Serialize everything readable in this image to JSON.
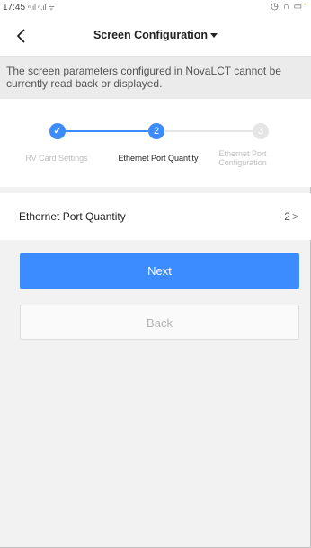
{
  "status_bar": {
    "time": "17:45",
    "signal_text": "⁴ᴳ.ıl ⁴ᴳ.ıl",
    "right_icons_text": "⏰ 🎧 ▮"
  },
  "nav": {
    "title": "Screen Configuration"
  },
  "notice": {
    "text": "The screen parameters configured in NovaLCT cannot be currently read back or displayed."
  },
  "stepper": {
    "steps": [
      {
        "number": "✓",
        "label": "RV Card Settings",
        "state": "done"
      },
      {
        "number": "2",
        "label": "Ethernet Port Quantity",
        "state": "active"
      },
      {
        "number": "3",
        "label": "Ethernet Port Configuration",
        "state": "pending"
      }
    ],
    "colors": {
      "active": "#3c8cff",
      "pending": "#e5e5e5",
      "muted_text": "#bdbdbd",
      "active_text": "#222222"
    }
  },
  "port_quantity": {
    "label": "Ethernet Port Quantity",
    "value": "2",
    "chevron": ">"
  },
  "buttons": {
    "next_label": "Next",
    "back_label": "Back"
  }
}
